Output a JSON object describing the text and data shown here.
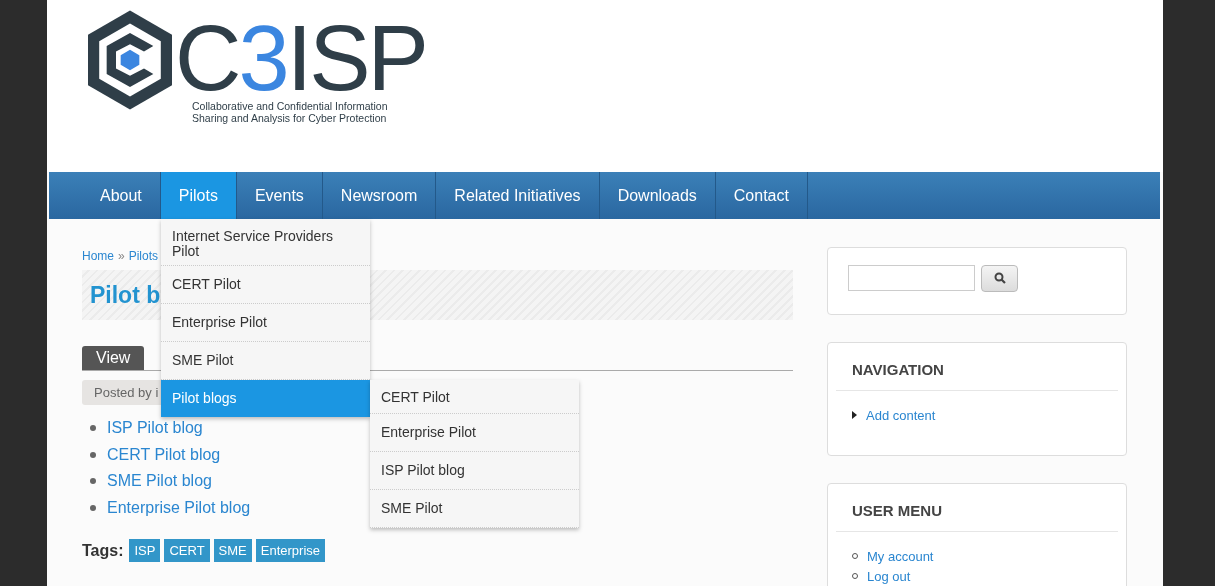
{
  "logo": {
    "wordmark": [
      {
        "text": "C",
        "color": "#2f3e48"
      },
      {
        "text": "3",
        "color": "#3b86e0"
      },
      {
        "text": "ISP",
        "color": "#2f3e48"
      }
    ],
    "tagline": [
      "Collaborative and Confidential Information",
      "Sharing and Analysis for Cyber Protection"
    ]
  },
  "nav": [
    {
      "label": "About",
      "selected": false
    },
    {
      "label": "Pilots",
      "selected": true
    },
    {
      "label": "Events",
      "selected": false
    },
    {
      "label": "Newsroom",
      "selected": false
    },
    {
      "label": "Related Initiatives",
      "selected": false
    },
    {
      "label": "Downloads",
      "selected": false
    },
    {
      "label": "Contact",
      "selected": false
    }
  ],
  "dropdown": [
    {
      "label": "Internet Service Providers Pilot",
      "selected": false
    },
    {
      "label": "CERT Pilot",
      "selected": false
    },
    {
      "label": "Enterprise Pilot",
      "selected": false
    },
    {
      "label": "SME Pilot",
      "selected": false
    },
    {
      "label": "Pilot blogs",
      "selected": true,
      "children": [
        {
          "label": "CERT Pilot"
        },
        {
          "label": "Enterprise Pilot"
        },
        {
          "label": "ISP Pilot blog"
        },
        {
          "label": "SME Pilot"
        }
      ]
    }
  ],
  "breadcrumb": {
    "items": [
      "Home",
      "Pilots"
    ],
    "separator": "»"
  },
  "title": "Pilot b",
  "tabs": [
    {
      "label": "View",
      "selected": true
    }
  ],
  "posted_by": "Posted by i",
  "links": [
    "ISP Pilot blog",
    "CERT Pilot blog",
    "SME Pilot blog",
    "Enterprise Pilot blog"
  ],
  "tags": {
    "label": "Tags:",
    "items": [
      "ISP",
      "CERT",
      "SME",
      "Enterprise"
    ]
  },
  "sidebar": {
    "blocks": [
      {
        "title": "NAVIGATION",
        "kind": "arrow",
        "items": [
          "Add content"
        ]
      },
      {
        "title": "USER MENU",
        "kind": "bullet",
        "items": [
          "My account",
          "Log out"
        ]
      }
    ]
  }
}
